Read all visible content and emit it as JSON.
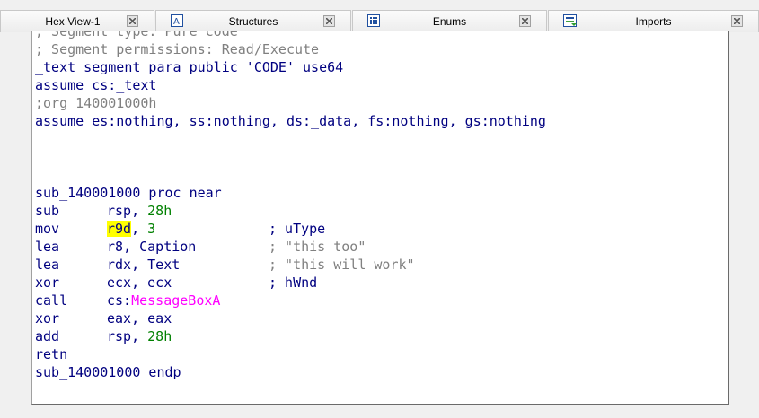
{
  "tabs": [
    {
      "label": "Hex View-1",
      "icon": "hex-view-icon"
    },
    {
      "label": "Structures",
      "icon": "structures-icon"
    },
    {
      "label": "Enums",
      "icon": "enums-icon"
    },
    {
      "label": "Imports",
      "icon": "imports-icon"
    }
  ],
  "code": {
    "header_comment_1": "; Segment type: Pure code",
    "header_comment_2": "; Segment permissions: Read/Execute",
    "segment_line": "_text segment para public 'CODE' use64",
    "assume_1": "assume cs:_text",
    "org_line": ";org 140001000h",
    "assume_2": "assume es:nothing, ss:nothing, ds:_data, fs:nothing, gs:nothing",
    "proc_start": "sub_140001000 proc near",
    "instructions": [
      {
        "mnemonic": "sub",
        "op1": "rsp",
        "op2": "28h",
        "comment": ""
      },
      {
        "mnemonic": "mov",
        "op1": "r9d",
        "op2": "3",
        "comment": "; uType"
      },
      {
        "mnemonic": "lea",
        "op1": "r8",
        "op2": "Caption",
        "comment": "; \"this too\""
      },
      {
        "mnemonic": "lea",
        "op1": "rdx",
        "op2": "Text",
        "comment": "; \"this will work\""
      },
      {
        "mnemonic": "xor",
        "op1": "ecx",
        "op2": "ecx",
        "comment": "; hWnd"
      },
      {
        "mnemonic": "call",
        "op1": "cs:",
        "op2": "MessageBoxA",
        "comment": ""
      },
      {
        "mnemonic": "xor",
        "op1": "eax",
        "op2": "eax",
        "comment": ""
      },
      {
        "mnemonic": "add",
        "op1": "rsp",
        "op2": "28h",
        "comment": ""
      },
      {
        "mnemonic": "retn",
        "op1": "",
        "op2": "",
        "comment": ""
      }
    ],
    "proc_end": "sub_140001000 endp",
    "comma": ", "
  },
  "colors": {
    "code_blue": "#000080",
    "comment_gray": "#808080",
    "number_green": "#008000",
    "import_magenta": "#ff00ff",
    "highlight_yellow": "#ffff00"
  }
}
